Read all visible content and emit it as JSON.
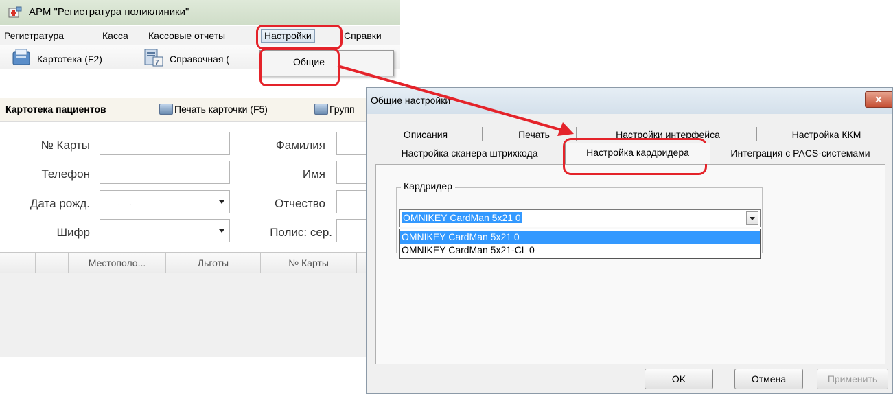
{
  "app": {
    "title": "АРМ \"Регистратура поликлиники\""
  },
  "menu": {
    "items": [
      "Регистратура",
      "Касса",
      "Кассовые отчеты",
      "Настройки",
      "Справки"
    ],
    "active": "Настройки",
    "dropdown_item": "Общие"
  },
  "toolbar": {
    "cardfile": "Картотека (F2)",
    "reference": "Справочная ("
  },
  "toolbar2": {
    "title": "Картотека пациентов",
    "print_card": "Печать карточки (F5)",
    "group": "Групп"
  },
  "form": {
    "card_no_label": "№ Карты",
    "phone_label": "Телефон",
    "birth_label": "Дата рожд.",
    "code_label": "Шифр",
    "surname_label": "Фамилия",
    "name_label": "Имя",
    "patronymic_label": "Отчество",
    "policy_label": "Полис: сер."
  },
  "grid": {
    "columns": [
      "",
      "",
      "Местополо...",
      "Льготы",
      "№ Карты",
      ""
    ]
  },
  "dialog": {
    "title": "Общие настройки",
    "tabs_row1": [
      "Описания",
      "Печать",
      "Настройки интерфейса",
      "Настройка ККМ"
    ],
    "tabs_row2": [
      "Настройка сканера штрихкода",
      "Настройка кардридера",
      "Интеграция с PACS-системами"
    ],
    "active_tab": "Настройка кардридера",
    "group_title": "Кардридер",
    "selected_reader": "OMNIKEY CardMan 5x21 0",
    "options": [
      "OMNIKEY CardMan 5x21 0",
      "OMNIKEY CardMan 5x21-CL 0"
    ],
    "buttons": {
      "ok": "OK",
      "cancel": "Отмена",
      "apply": "Применить"
    }
  },
  "colors": {
    "highlight": "#e4232a",
    "selection": "#3399ff"
  }
}
